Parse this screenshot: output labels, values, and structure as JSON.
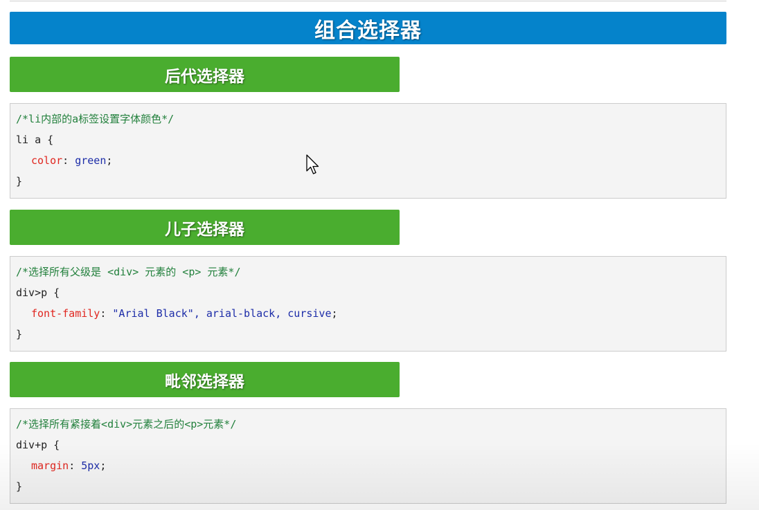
{
  "main_title": "组合选择器",
  "sections": [
    {
      "title": "后代选择器",
      "code": {
        "comment": "/*li内部的a标签设置字体颜色*/",
        "selector": "li a {",
        "property": "color",
        "colon": ": ",
        "value": "green",
        "semicolon": ";",
        "close": "}"
      }
    },
    {
      "title": "儿子选择器",
      "code": {
        "comment": "/*选择所有父级是 <div> 元素的 <p> 元素*/",
        "selector": "div>p {",
        "property": "font-family",
        "colon": ": ",
        "value_string": "\"Arial Black\"",
        "value_rest": ", arial-black, cursive",
        "semicolon": ";",
        "close": "}"
      }
    },
    {
      "title": "毗邻选择器",
      "code": {
        "comment": "/*选择所有紧接着<div>元素之后的<p>元素*/",
        "selector": "div+p {",
        "property": "margin",
        "colon": ": ",
        "value": "5px",
        "semicolon": ";",
        "close": "}"
      }
    }
  ],
  "icons": {
    "cursor": "mouse-pointer-icon"
  },
  "colors": {
    "main_title_bg": "#0583cb",
    "sub_title_bg": "#4aad2f",
    "code_bg": "#f4f4f4",
    "comment": "#22803c",
    "property": "#e0261f",
    "value": "#1c2ca8"
  }
}
